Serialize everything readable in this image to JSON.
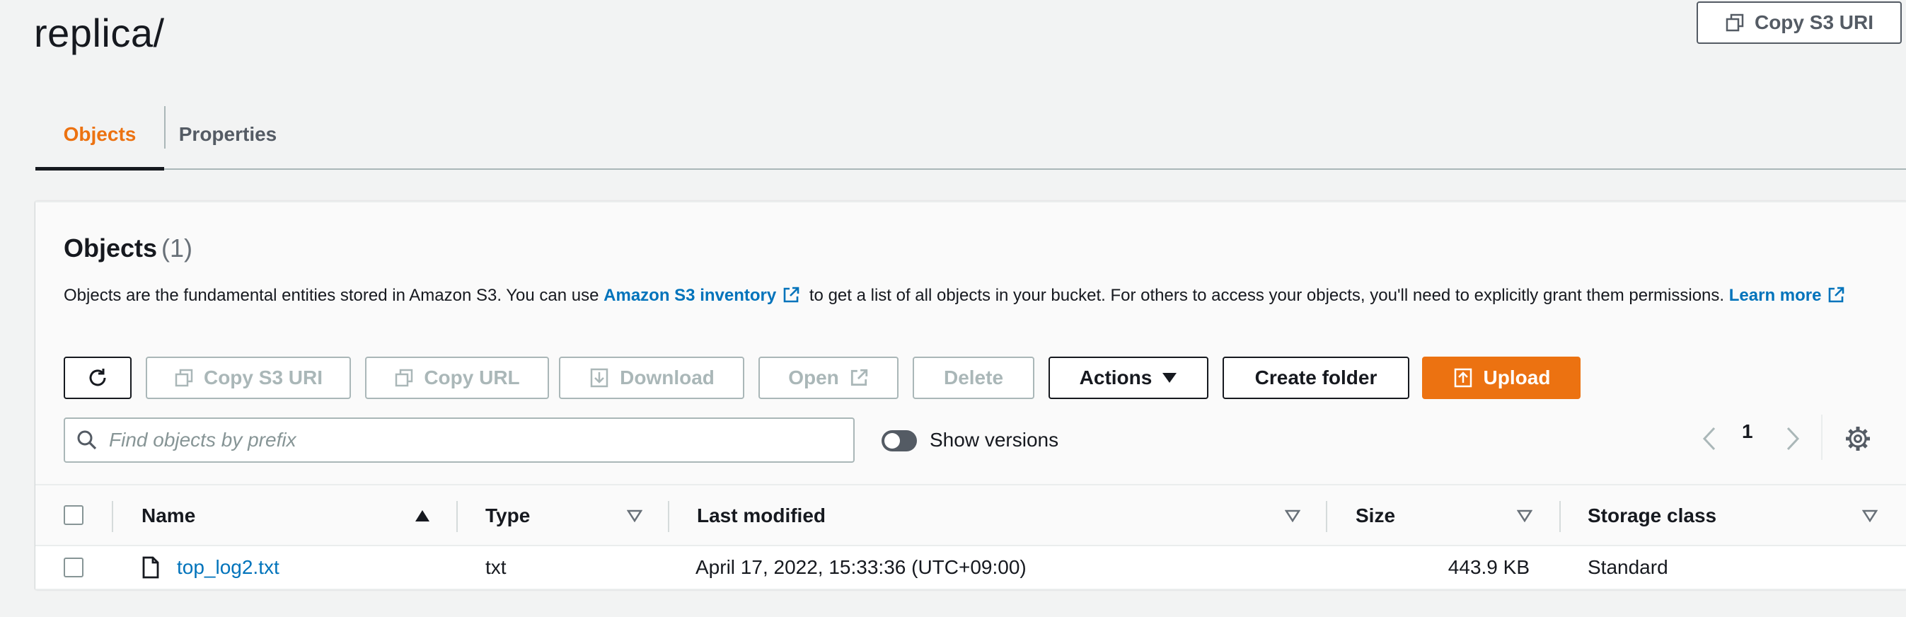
{
  "header": {
    "title": "replica/",
    "copy_s3_uri_label": "Copy S3 URI"
  },
  "tabs": [
    {
      "label": "Objects",
      "active": true
    },
    {
      "label": "Properties",
      "active": false
    }
  ],
  "objects_panel": {
    "title": "Objects",
    "count": "(1)",
    "description": {
      "part1": "Objects are the fundamental entities stored in Amazon S3. You can use ",
      "inventory_link": "Amazon S3 inventory",
      "part2": " to get a list of all objects in your bucket. For others to access your objects, you'll need to explicitly grant them permissions. ",
      "learn_more_link": "Learn more"
    },
    "toolbar": {
      "refresh_icon": "refresh-icon",
      "copy_s3_uri": "Copy S3 URI",
      "copy_url": "Copy URL",
      "download": "Download",
      "open": "Open",
      "delete": "Delete",
      "actions": "Actions",
      "create_folder": "Create folder",
      "upload": "Upload"
    },
    "search": {
      "placeholder": "Find objects by prefix",
      "value": ""
    },
    "show_versions": {
      "label": "Show versions",
      "enabled": false
    },
    "pagination": {
      "current_page": "1"
    },
    "table": {
      "columns": [
        "Name",
        "Type",
        "Last modified",
        "Size",
        "Storage class"
      ],
      "sorted_column": "Name",
      "rows": [
        {
          "name": "top_log2.txt",
          "type": "txt",
          "last_modified": "April 17, 2022, 15:33:36 (UTC+09:00)",
          "size": "443.9 KB",
          "storage_class": "Standard"
        }
      ]
    }
  },
  "colors": {
    "accent": "#ec7211",
    "link": "#0073bb",
    "text": "#16191f",
    "disabled": "#aab7b8",
    "background": "#f2f3f3"
  }
}
